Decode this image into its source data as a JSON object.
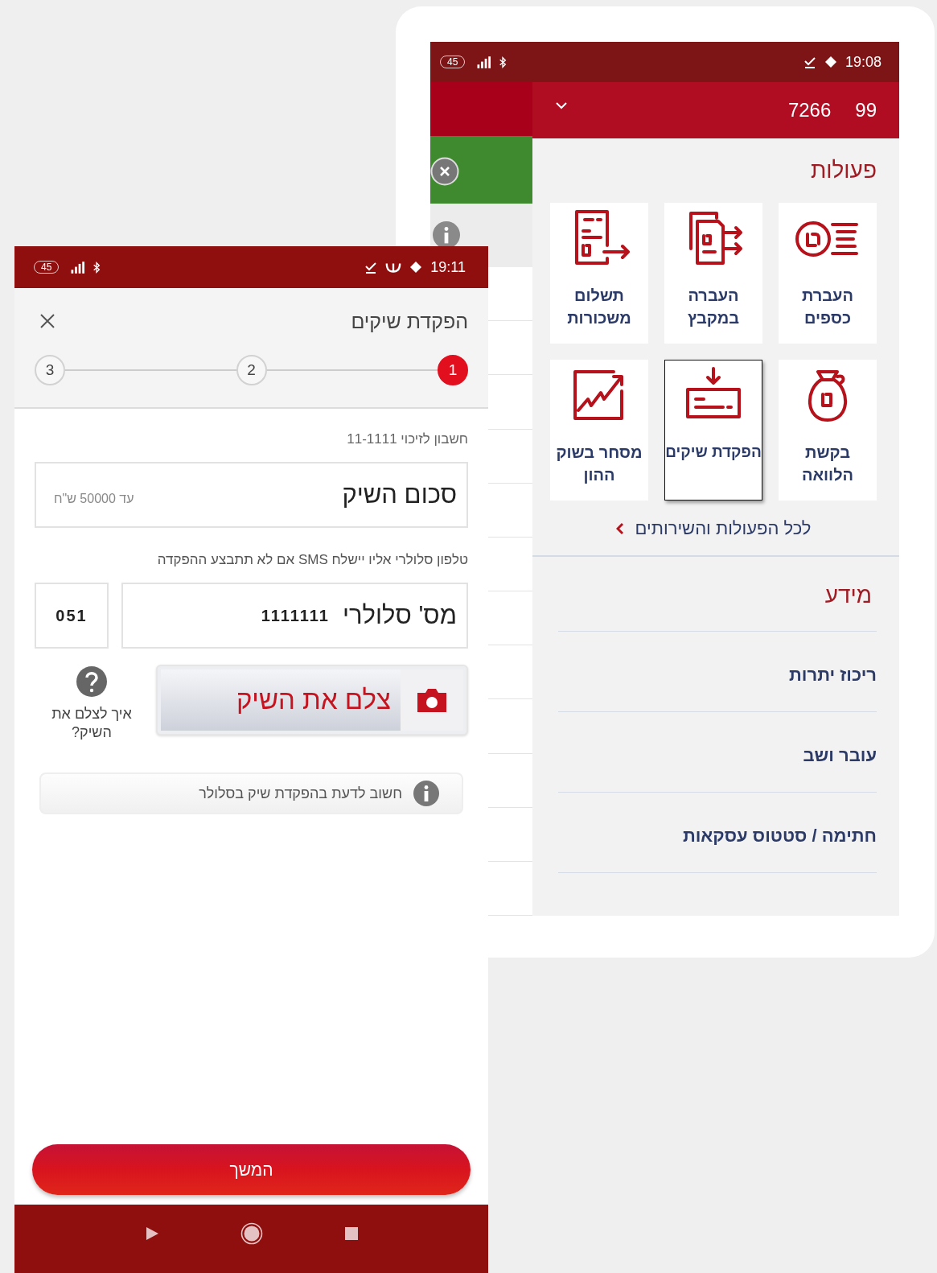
{
  "back_phone": {
    "status_bar": {
      "battery": "45",
      "time": "19:08"
    },
    "account_header": {
      "branch": "99",
      "account": "7266"
    },
    "actions": {
      "title": "פעולות",
      "tiles": [
        {
          "label": "העברת כספים",
          "kind": "coin",
          "selected": false
        },
        {
          "label": "העברה במקבץ",
          "kind": "files",
          "selected": false
        },
        {
          "label": "תשלום משכורות",
          "kind": "invoice",
          "selected": false
        },
        {
          "label": "בקשת הלוואה",
          "kind": "bag",
          "selected": false
        },
        {
          "label": "הפקדת שיקים",
          "kind": "cheque",
          "selected": true
        },
        {
          "label": "מסחר בשוק ההון",
          "kind": "chart",
          "selected": false
        }
      ],
      "all_link": "לכל הפעולות והשירותים"
    },
    "info": {
      "title": "מידע",
      "items": [
        "ריכוז יתרות",
        "עובר ושב",
        "חתימה / סטטוס עסקאות"
      ]
    }
  },
  "front_phone": {
    "status_bar": {
      "battery": "45",
      "time": "19:11"
    },
    "title": "הפקדת שיקים",
    "steps": [
      {
        "label": "1",
        "selected": true
      },
      {
        "label": "2",
        "selected": false
      },
      {
        "label": "3",
        "selected": false
      }
    ],
    "account_line": "חשבון לזיכוי 11-1111",
    "amount_field": {
      "label": "סכום השיק",
      "placeholder": "עד 50000 ש\"ח"
    },
    "phone_hint": "טלפון סלולרי אליו יישלח SMS אם לא תתבצע ההפקדה",
    "phone_field": {
      "label": "מס' סלולרי",
      "value": "1111111"
    },
    "prefix_field": {
      "value": "051"
    },
    "photo_button": "צלם את השיק",
    "help_text": "איך לצלם את השיק?",
    "notice": "חשוב לדעת בהפקדת שיק בסלולר",
    "continue_button": "המשך"
  }
}
